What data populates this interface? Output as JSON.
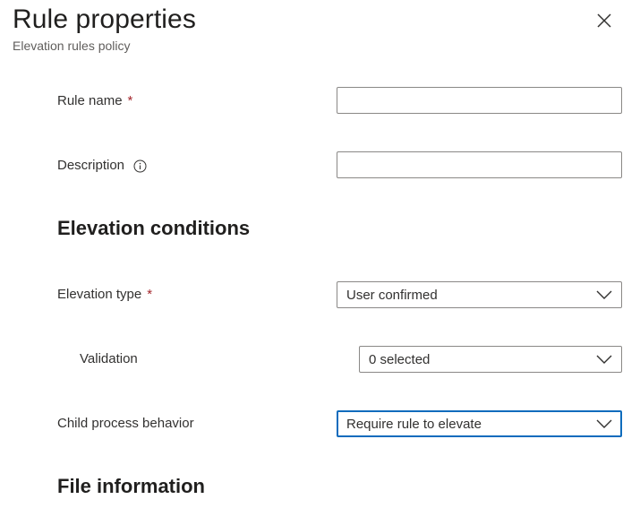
{
  "header": {
    "title": "Rule properties",
    "subtitle": "Elevation rules policy",
    "close_icon": "close-icon"
  },
  "fields": {
    "rule_name": {
      "label": "Rule name",
      "required_marker": "*",
      "value": ""
    },
    "description": {
      "label": "Description",
      "info_icon": "info-icon",
      "value": ""
    }
  },
  "sections": {
    "elevation_conditions": "Elevation conditions",
    "file_information": "File information"
  },
  "elevation": {
    "type": {
      "label": "Elevation type",
      "required_marker": "*",
      "selected": "User confirmed"
    },
    "validation": {
      "label": "Validation",
      "selected": "0 selected"
    },
    "child_process": {
      "label": "Child process behavior",
      "selected": "Require rule to elevate"
    }
  },
  "colors": {
    "required": "#a4262c",
    "focus_border": "#0f6cbd",
    "input_border": "#8a8886"
  }
}
